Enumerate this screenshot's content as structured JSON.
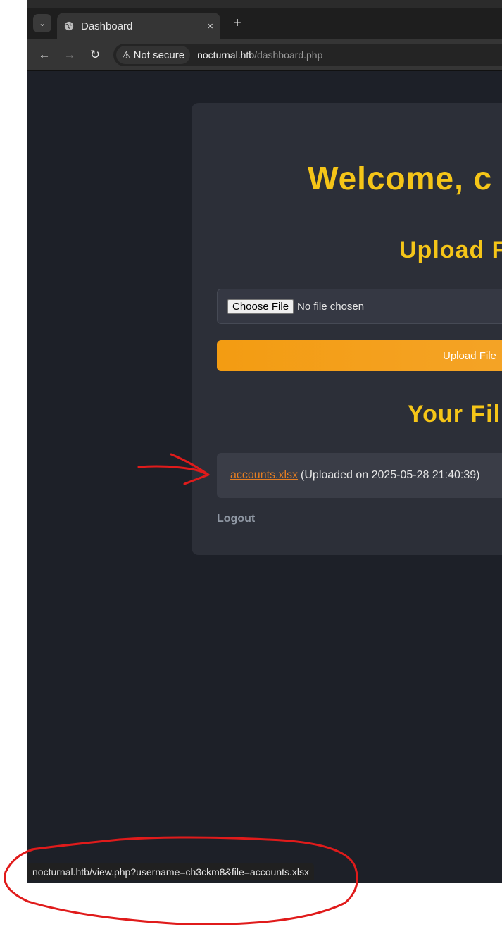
{
  "tabstrip": {
    "tab_title": "Dashboard",
    "close_glyph": "×",
    "new_tab_glyph": "+",
    "search_glyph": "⌄"
  },
  "toolbar": {
    "back_glyph": "←",
    "forward_glyph": "→",
    "reload_glyph": "↻",
    "security_label": "Not secure",
    "url_host": "nocturnal.htb",
    "url_path": "/dashboard.php"
  },
  "page": {
    "welcome": "Welcome, c",
    "upload_heading": "Upload F",
    "choose_file_label": "Choose File",
    "no_file_text": "No file chosen",
    "upload_button": "Upload File",
    "files_heading": "Your Fil",
    "files": [
      {
        "name": "accounts.xlsx",
        "meta": "(Uploaded on 2025-05-28 21:40:39)"
      }
    ],
    "logout": "Logout"
  },
  "status_url": "nocturnal.htb/view.php?username=ch3ckm8&file=accounts.xlsx",
  "colors": {
    "accent": "#f5c518",
    "button": "#f39c12",
    "link": "#e67e22",
    "annotation": "#e01b1b"
  },
  "icons": [
    "tab-search-icon",
    "globe-icon",
    "close-icon",
    "new-tab-icon",
    "back-icon",
    "forward-icon",
    "reload-icon",
    "warning-icon"
  ]
}
